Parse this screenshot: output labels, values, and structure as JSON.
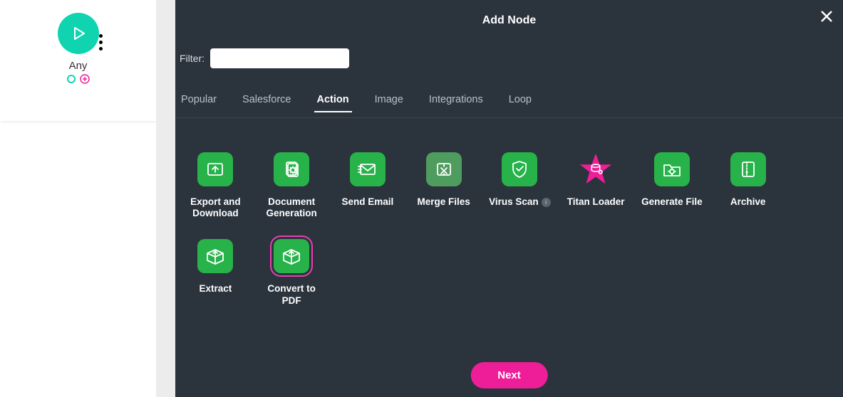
{
  "left": {
    "node_label": "Any"
  },
  "modal": {
    "title": "Add Node",
    "filter_label": "Filter:",
    "filter_value": "",
    "tabs": [
      {
        "label": "Popular"
      },
      {
        "label": "Salesforce"
      },
      {
        "label": "Action"
      },
      {
        "label": "Image"
      },
      {
        "label": "Integrations"
      },
      {
        "label": "Loop"
      }
    ],
    "active_tab": "Action",
    "actions": [
      {
        "label": "Export and Download",
        "icon": "upload-icon"
      },
      {
        "label": "Document Generation",
        "icon": "doc-gear-icon"
      },
      {
        "label": "Send Email",
        "icon": "envelope-icon"
      },
      {
        "label": "Merge Files",
        "icon": "merge-icon",
        "dim": true
      },
      {
        "label": "Virus Scan",
        "icon": "shield-icon",
        "info": true
      },
      {
        "label": "Titan Loader",
        "icon": "star-db-icon",
        "special": "star"
      },
      {
        "label": "Generate File",
        "icon": "folder-gear-icon"
      },
      {
        "label": "Archive",
        "icon": "zip-icon"
      },
      {
        "label": "Extract",
        "icon": "box-extract-icon"
      },
      {
        "label": "Convert to PDF",
        "icon": "box-convert-icon",
        "selected": true
      }
    ],
    "next_label": "Next"
  },
  "colors": {
    "accent_green": "#27b24a",
    "accent_teal": "#10d4b0",
    "accent_pink": "#ed1e98",
    "panel_bg": "#2b333d"
  }
}
